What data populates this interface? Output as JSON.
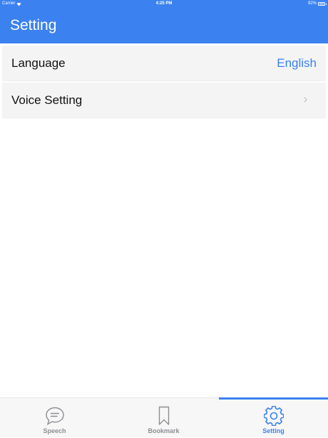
{
  "status_bar": {
    "carrier": "Carrier",
    "time": "4:25 PM",
    "battery": "92%",
    "icons": [
      "wifi-icon",
      "battery-icon"
    ]
  },
  "nav": {
    "title": "Setting"
  },
  "settings": {
    "language": {
      "label": "Language",
      "value": "English"
    },
    "voice": {
      "label": "Voice Setting",
      "icon": "chevron-right-icon"
    }
  },
  "tabs": [
    {
      "label": "Speech",
      "icon": "speech-bubble-icon",
      "selected": false
    },
    {
      "label": "Bookmark",
      "icon": "bookmark-icon",
      "selected": false
    },
    {
      "label": "Setting",
      "icon": "gear-icon",
      "selected": true
    }
  ],
  "colors": {
    "accent": "#3b82f0",
    "row_background": "#f4f4f4",
    "tab_inactive": "#8e8e93",
    "tab_bar_background": "#f7f7f7"
  }
}
